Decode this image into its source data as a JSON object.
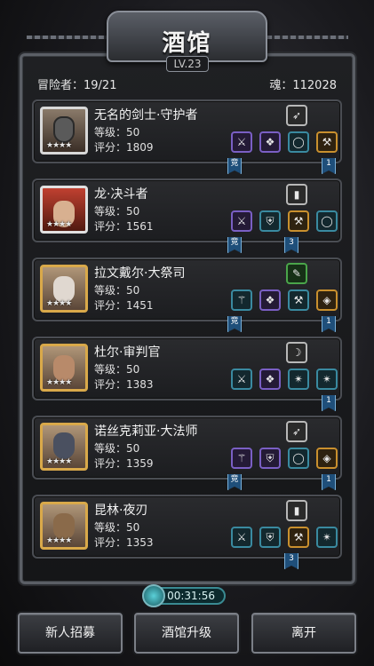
{
  "header": {
    "title": "酒馆",
    "level": "LV.23"
  },
  "stats": {
    "adventurers": "冒险者：19/21",
    "souls": "魂：112028"
  },
  "heroes": [
    {
      "name": "无名的剑士·守护者",
      "level": "等级：50",
      "score": "评分：1809",
      "stars": "★★★★",
      "slots": [
        "⚔",
        "❖",
        "◯",
        "⚒"
      ],
      "special": "➶",
      "ribbons": [
        "竞",
        "1"
      ]
    },
    {
      "name": "龙·决斗者",
      "level": "等级：50",
      "score": "评分：1561",
      "stars": "★★★★",
      "slots": [
        "⚔",
        "⛨",
        "⚒",
        "◯"
      ],
      "special": "▮",
      "ribbons": [
        "竞",
        "3"
      ]
    },
    {
      "name": "拉文戴尔·大祭司",
      "level": "等级：50",
      "score": "评分：1451",
      "stars": "★★★★",
      "slots": [
        "⚚",
        "❖",
        "⚒",
        "◈"
      ],
      "special": "✎",
      "ribbons": [
        "竞",
        "1"
      ]
    },
    {
      "name": "杜尔·审判官",
      "level": "等级：50",
      "score": "评分：1383",
      "stars": "★★★★",
      "slots": [
        "⚔",
        "❖",
        "✴",
        "✴"
      ],
      "special": "☽",
      "ribbons": [
        "1"
      ]
    },
    {
      "name": "诺丝克莉亚·大法师",
      "level": "等级：50",
      "score": "评分：1359",
      "stars": "★★★★",
      "slots": [
        "⚚",
        "⛨",
        "◯",
        "◈"
      ],
      "special": "➶",
      "ribbons": [
        "竞",
        "1"
      ]
    },
    {
      "name": "昆林·夜刃",
      "level": "等级：50",
      "score": "评分：1353",
      "stars": "★★★★",
      "slots": [
        "⚔",
        "⛨",
        "⚒",
        "✴"
      ],
      "special": "▮",
      "ribbons": [
        "3"
      ]
    }
  ],
  "timer": "00:31:56",
  "buttons": {
    "recruit": "新人招募",
    "upgrade": "酒馆升级",
    "leave": "离开"
  }
}
